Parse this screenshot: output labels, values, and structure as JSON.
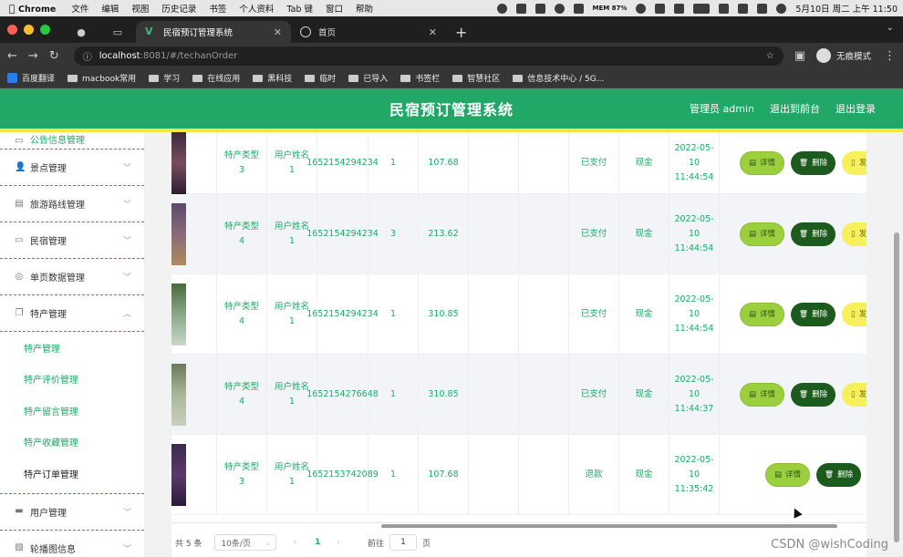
{
  "macos_menu": {
    "app": "Chrome",
    "items": [
      "文件",
      "编辑",
      "视图",
      "历史记录",
      "书签",
      "个人资料",
      "Tab 键",
      "窗口",
      "帮助"
    ],
    "mem": "MEM 87%",
    "datetime": "5月10日 周二 上午 11:50"
  },
  "browser": {
    "tabs": [
      {
        "title": "民宿预订管理系统",
        "active": true
      },
      {
        "title": "首页",
        "active": false
      }
    ],
    "url_host": "localhost",
    "url_path": ":8081/#/techanOrder",
    "profile": "无痕模式",
    "bookmarks": [
      "百度翻译",
      "macbook常用",
      "学习",
      "在线应用",
      "黑科技",
      "临时",
      "已导入",
      "书签栏",
      "智慧社区",
      "信息技术中心 / 5G..."
    ]
  },
  "header": {
    "title": "民宿预订管理系统",
    "admin": "管理员 admin",
    "to_front": "退出到前台",
    "logout": "退出登录"
  },
  "sidebar": {
    "partial_top": "公告信息管理",
    "items": [
      {
        "label": "景点管理",
        "icon": "user-icon"
      },
      {
        "label": "旅游路线管理",
        "icon": "chart-icon"
      },
      {
        "label": "民宿管理",
        "icon": "chat-icon"
      },
      {
        "label": "单页数据管理",
        "icon": "compass-icon"
      }
    ],
    "open_group": {
      "label": "特产管理",
      "icon": "copy-icon"
    },
    "sub_items": [
      "特产管理",
      "特产评价管理",
      "特产留言管理",
      "特产收藏管理",
      "特产订单管理"
    ],
    "active_sub": "特产订单管理",
    "bottom_items": [
      {
        "label": "用户管理",
        "icon": "monitor-icon"
      },
      {
        "label": "轮播图信息",
        "icon": "picture-icon"
      }
    ]
  },
  "buttons": {
    "detail": "详情",
    "delete": "删除",
    "more": "发"
  },
  "rows": [
    {
      "type": "特产类型3",
      "user": "用户姓名1",
      "order_no": "1652154294234",
      "qty": "1",
      "price": "107.68",
      "status": "已支付",
      "pay": "现金",
      "time": "2022-05-10 11:44:54",
      "has_more": true,
      "height": 68
    },
    {
      "type": "特产类型4",
      "user": "用户姓名1",
      "order_no": "1652154294234",
      "qty": "3",
      "price": "213.62",
      "status": "已支付",
      "pay": "现金",
      "time": "2022-05-10 11:44:54",
      "has_more": true,
      "height": 88
    },
    {
      "type": "特产类型4",
      "user": "用户姓名1",
      "order_no": "1652154294234",
      "qty": "1",
      "price": "310.85",
      "status": "已支付",
      "pay": "现金",
      "time": "2022-05-10 11:44:54",
      "has_more": true,
      "height": 88
    },
    {
      "type": "特产类型4",
      "user": "用户姓名1",
      "order_no": "1652154276648",
      "qty": "1",
      "price": "310.85",
      "status": "已支付",
      "pay": "现金",
      "time": "2022-05-10 11:44:37",
      "has_more": true,
      "height": 88
    },
    {
      "type": "特产类型3",
      "user": "用户姓名1",
      "order_no": "1652153742089",
      "qty": "1",
      "price": "107.68",
      "status": "退款",
      "pay": "现金",
      "time": "2022-05-10 11:35:42",
      "has_more": false,
      "height": 88
    }
  ],
  "pager": {
    "total": "共 5 条",
    "page_size": "10条/页",
    "current": "1",
    "goto_prefix": "前往",
    "goto_value": "1",
    "goto_suffix": "页"
  },
  "watermark": "CSDN @wishCoding",
  "colors": {
    "primary": "#21a867",
    "accent_yellow": "#f5e63c",
    "detail_btn": "#9ccf3e",
    "delete_btn": "#1d5a1d"
  }
}
